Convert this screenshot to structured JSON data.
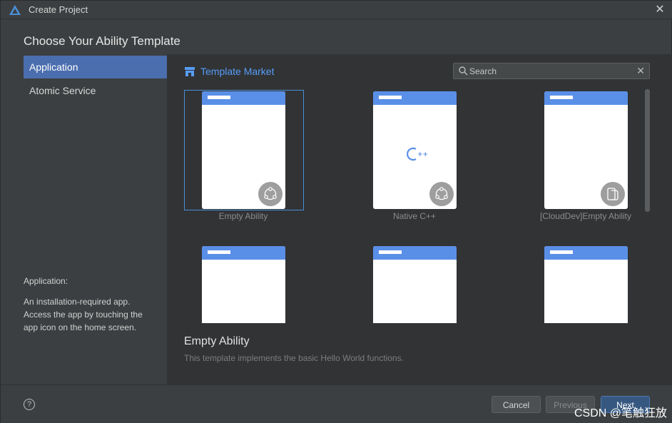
{
  "window": {
    "title": "Create Project",
    "close_icon": "close-icon"
  },
  "page": {
    "heading": "Choose Your Ability Template"
  },
  "sidebar": {
    "items": [
      {
        "label": "Application",
        "selected": true
      },
      {
        "label": "Atomic Service",
        "selected": false
      }
    ],
    "description_title": "Application:",
    "description_body": "An installation-required app. Access the app by touching the app icon on the home screen."
  },
  "market": {
    "label": "Template Market",
    "icon": "store-icon"
  },
  "search": {
    "placeholder": "Search",
    "value": ""
  },
  "templates": [
    {
      "label": "Empty Ability",
      "badge": "share-icon",
      "selected": true
    },
    {
      "label": "Native C++",
      "badge": "share-icon",
      "center": "C++"
    },
    {
      "label": "[CloudDev]Empty Ability",
      "badge": "cloud-device-icon"
    },
    {
      "label": ""
    },
    {
      "label": ""
    },
    {
      "label": ""
    }
  ],
  "detail": {
    "title": "Empty Ability",
    "description": "This template implements the basic Hello World functions."
  },
  "footer": {
    "help": "?",
    "cancel": "Cancel",
    "previous": "Previous",
    "next": "Next"
  },
  "watermark": "CSDN @笔触狂放",
  "colors": {
    "accent": "#4b6eaf",
    "link": "#589df6",
    "card_header": "#5a8fe8",
    "background": "#3c3f41",
    "panel": "#313335"
  }
}
